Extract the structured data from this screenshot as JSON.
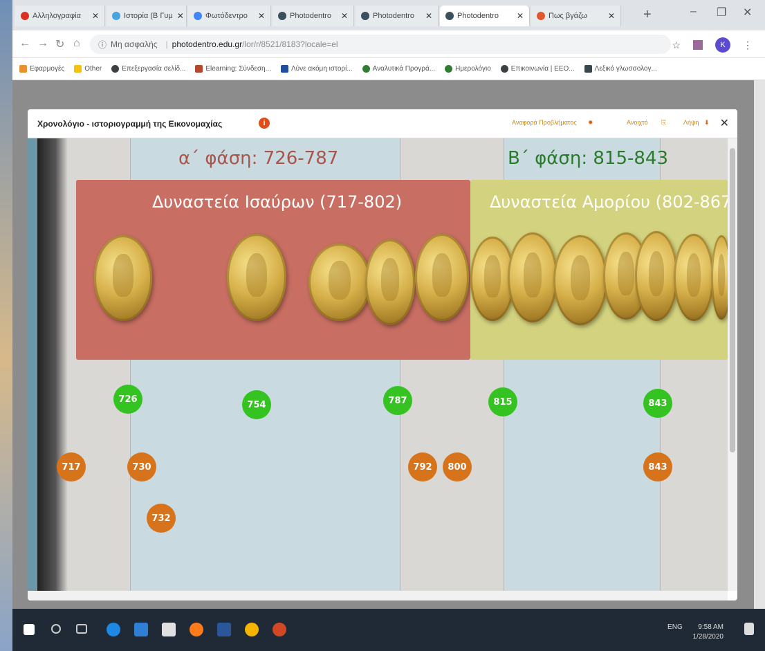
{
  "tabs": [
    {
      "label": "Αλληλογραφία",
      "color": "#d93025",
      "active": false
    },
    {
      "label": "Ιστορία (Β Γυμ",
      "color": "#4aa3df",
      "active": false
    },
    {
      "label": "Φωτόδεντρο",
      "color": "#4285f4",
      "active": false
    },
    {
      "label": "Photodentro",
      "color": "#3b4f5c",
      "active": false
    },
    {
      "label": "Photodentro",
      "color": "#3b4f5c",
      "active": false
    },
    {
      "label": "Photodentro",
      "color": "#3b4f5c",
      "active": true
    },
    {
      "label": "Πως βγάζω",
      "color": "#e4572e",
      "active": false
    }
  ],
  "window": {
    "minimize": "–",
    "maximize": "❐",
    "close": "✕",
    "newtab": "+"
  },
  "address": {
    "security": "Μη ασφαλής",
    "domain": "photodentro.edu.gr",
    "path": "/lor/r/8521/8183?locale=el",
    "avatar_letter": "K"
  },
  "bookmarks": [
    {
      "label": "Εφαρμογές",
      "color": "#e8912d"
    },
    {
      "label": "Other",
      "color": "#f4c20d"
    },
    {
      "label": "Επεξεργασία σελίδ...",
      "color": "#3c4043"
    },
    {
      "label": "Elearning: Σύνδεση...",
      "color": "#b7472a"
    },
    {
      "label": "Λύνε ακόμη ιστορί...",
      "color": "#1e4e9c"
    },
    {
      "label": "Αναλυτικά Προγρά...",
      "color": "#2e7d32"
    },
    {
      "label": "Ημερολόγιο",
      "color": "#2e7d32"
    },
    {
      "label": "Επικοινωνία | ΕΕΟ...",
      "color": "#3c4043"
    },
    {
      "label": "Λεξικό γλωσσολογ...",
      "color": "#37474f"
    }
  ],
  "modal": {
    "title": "Χρονολόγιο - ιστοριογραμμή της Εικονομαχίας",
    "report_link": "Αναφορά Προβλήματος",
    "embed_link": "Ανοιχτό",
    "download_link": "Λήψη"
  },
  "timeline": {
    "phase1": "α΄ φάση: 726-787",
    "phase2": "Β΄ φάση: 815-843",
    "dynasty1": "Δυναστεία Ισαύρων (717-802)",
    "dynasty2": "Δυναστεία Αμορίου (802-867",
    "green_years": [
      "726",
      "754",
      "787",
      "815",
      "843"
    ],
    "orange_years": [
      "717",
      "730",
      "732",
      "792",
      "800",
      "843"
    ],
    "colors": {
      "phase1": "#a8554b",
      "phase2": "#2b7a2b",
      "dynasty1_bg": "#c86e62",
      "dynasty2_bg": "#d3d27e",
      "green": "#34c321",
      "orange": "#d7731b"
    }
  },
  "taskbar": {
    "time": "9:58 AM",
    "date": "1/28/2020",
    "lang": "ENG"
  }
}
